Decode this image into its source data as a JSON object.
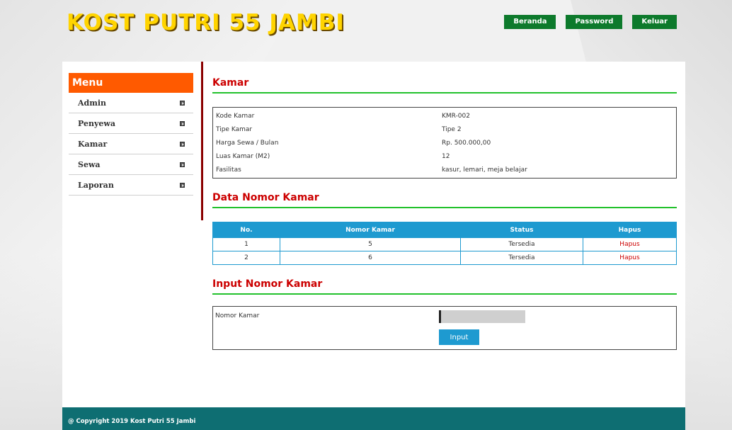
{
  "site": {
    "title": "KOST PUTRI 55 JAMBI"
  },
  "nav": {
    "beranda": "Beranda",
    "password": "Password",
    "keluar": "Keluar"
  },
  "sidebar": {
    "header": "Menu",
    "items": [
      {
        "label": "Admin"
      },
      {
        "label": "Penyewa"
      },
      {
        "label": "Kamar"
      },
      {
        "label": "Sewa"
      },
      {
        "label": "Laporan"
      }
    ]
  },
  "kamar": {
    "title": "Kamar",
    "rows": [
      {
        "label": "Kode Kamar",
        "value": "KMR-002"
      },
      {
        "label": "Tipe Kamar",
        "value": "Tipe 2"
      },
      {
        "label": "Harga Sewa / Bulan",
        "value": "Rp. 500.000,00"
      },
      {
        "label": "Luas Kamar (M2)",
        "value": "12"
      },
      {
        "label": "Fasilitas",
        "value": "kasur, lemari, meja belajar"
      }
    ]
  },
  "nomor_kamar": {
    "title": "Data Nomor Kamar",
    "columns": [
      "No.",
      "Nomor Kamar",
      "Status",
      "Hapus"
    ],
    "rows": [
      {
        "no": "1",
        "nomor": "5",
        "status": "Tersedia",
        "hapus": "Hapus"
      },
      {
        "no": "2",
        "nomor": "6",
        "status": "Tersedia",
        "hapus": "Hapus"
      }
    ]
  },
  "input_nomor": {
    "title": "Input Nomor Kamar",
    "label": "Nomor Kamar",
    "value": "",
    "button": "Input"
  },
  "footer": {
    "text": "@ Copyright 2019 Kost Putri 55 Jambi"
  },
  "colors": {
    "accent_green": "#0d7a2c",
    "menu_orange": "#ff5a00",
    "table_blue": "#1e9ad0",
    "title_red": "#cc0000",
    "footer_teal": "#0e6e72"
  }
}
